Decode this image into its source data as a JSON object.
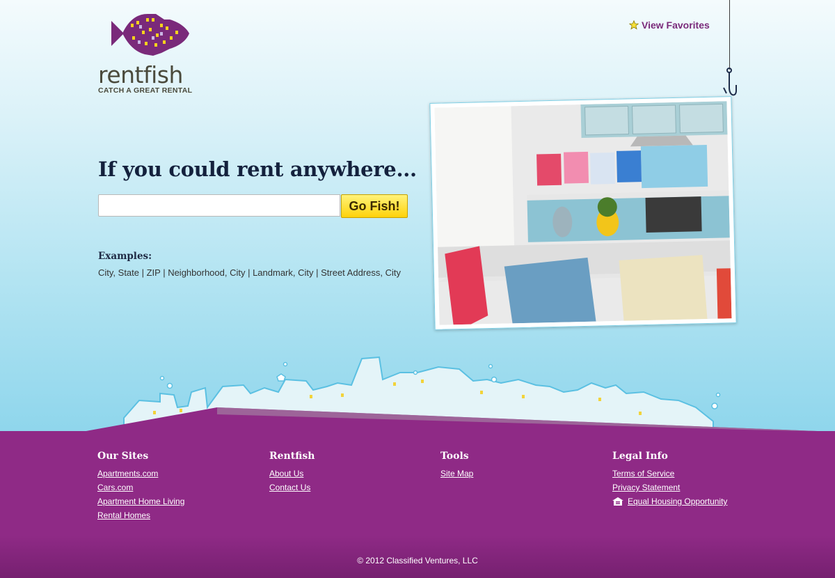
{
  "brand": {
    "name": "rentfish",
    "tagline": "CATCH A GREAT RENTAL",
    "purple": "#7a2a7a"
  },
  "header": {
    "favorites_label": "View Favorites",
    "favorites_icon": "star-icon"
  },
  "hero": {
    "heading": "If you could rent anywhere...",
    "search": {
      "value": "",
      "placeholder": ""
    },
    "go_label": "Go Fish!",
    "examples_heading": "Examples:",
    "examples_text": "City, State | ZIP | Neighborhood, City | Landmark, City | Street Address, City"
  },
  "footer": {
    "color": "#8f2a86",
    "columns": [
      {
        "title": "Our Sites",
        "links": [
          "Apartments.com",
          "Cars.com",
          "Apartment Home Living",
          "Rental Homes"
        ]
      },
      {
        "title": "Rentfish",
        "links": [
          "About Us",
          "Contact Us"
        ]
      },
      {
        "title": "Tools",
        "links": [
          "Site Map"
        ]
      },
      {
        "title": "Legal Info",
        "links": [
          "Terms of Service",
          "Privacy Statement",
          "Equal Housing Opportunity"
        ]
      }
    ],
    "equal_housing_icon": "equal-housing-icon",
    "copyright": "© 2012 Classified Ventures, LLC"
  }
}
